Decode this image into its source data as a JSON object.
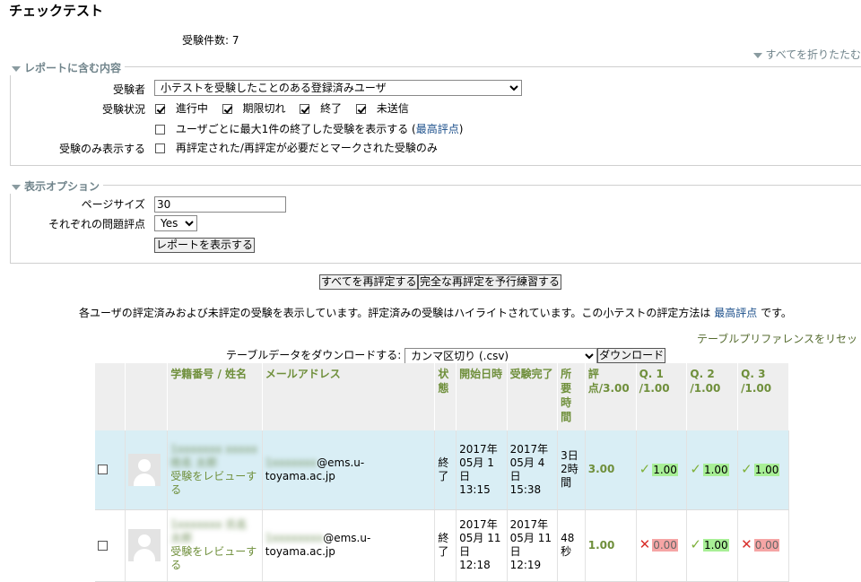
{
  "page_title": "チェックテスト",
  "attempt_count": "受験件数: 7",
  "collapse_all": "すべてを折りたたむ",
  "report_section": {
    "legend": "レポートに含む内容",
    "attempts_from_label": "受験者",
    "attempts_from_value": "小テストを受験したことのある登録済みユーザ",
    "state_label": "受験状況",
    "states": [
      {
        "label": "進行中",
        "checked": true
      },
      {
        "label": "期限切れ",
        "checked": true
      },
      {
        "label": "終了",
        "checked": true
      },
      {
        "label": "未送信",
        "checked": true
      }
    ],
    "best_attempt_text": "ユーザごとに最大1件の終了した受験を表示する (",
    "best_attempt_link": "最高評点",
    "best_attempt_close": ")",
    "only_regraded_label": "受験のみ表示する",
    "only_regraded_text": "再評定された/再評定が必要だとマークされた受験のみ"
  },
  "display_section": {
    "legend": "表示オプション",
    "page_size_label": "ページサイズ",
    "page_size_value": "30",
    "marks_label": "それぞれの問題評点",
    "marks_value": "Yes",
    "show_report_button": "レポートを表示する"
  },
  "regrade_all_button": "すべてを再評定する",
  "dry_run_button": "完全な再評定を予行練習する",
  "info_text": "各ユーザの評定済みおよび未評定の受験を表示しています。評定済みの受験はハイライトされています。この小テストの評定方法は ",
  "info_link": "最高評点",
  "info_suffix": " です。",
  "reset_prefs": "テーブルプリファレンスをリセットする",
  "download": {
    "label": "テーブルデータをダウンロードする:",
    "format": "カンマ区切り (.csv)",
    "button": "ダウンロード"
  },
  "table": {
    "headers": {
      "name": "学籍番号 / 姓名",
      "email": "メールアドレス",
      "state": "状態",
      "started": "開始日時",
      "completed": "受験完了",
      "duration": "所要時間",
      "grade": "評点/3.00",
      "q1": "Q. 1 /1.00",
      "q2": "Q. 2 /1.00",
      "q3": "Q. 3 /1.00"
    },
    "rows": [
      {
        "name_blurred": "1xxxxxxx xxxxx 姓名 太郎",
        "review": "受験をレビューする",
        "email_blurred": "1xxxxxxx",
        "email_domain": "@ems.u-toyama.ac.jp",
        "state": "終了",
        "started": "2017年 05月 1日 13:15",
        "completed": "2017年 05月 4日 15:38",
        "duration": "3日 2時間",
        "grade": "3.00",
        "q1": "1.00",
        "q1_ok": true,
        "q2": "1.00",
        "q2_ok": true,
        "q3": "1.00",
        "q3_ok": true
      },
      {
        "name_blurred": "1xxxxxxx 氏名 太郎",
        "review": "受験をレビューする",
        "email_blurred": "1xxxxxxxx",
        "email_domain": "@ems.u-toyama.ac.jp",
        "state": "終了",
        "started": "2017年 05月 11日 12:18",
        "completed": "2017年 05月 11日 12:19",
        "duration": "48秒",
        "grade": "1.00",
        "q1": "0.00",
        "q1_ok": false,
        "q2": "1.00",
        "q2_ok": true,
        "q3": "0.00",
        "q3_ok": false
      }
    ]
  }
}
